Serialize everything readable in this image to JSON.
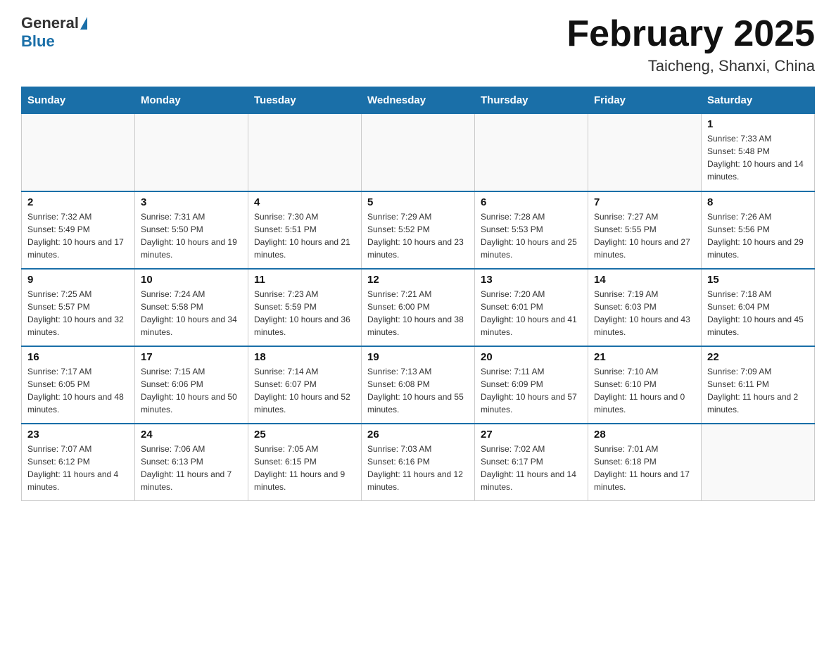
{
  "header": {
    "logo_text_general": "General",
    "logo_text_blue": "Blue",
    "title": "February 2025",
    "subtitle": "Taicheng, Shanxi, China"
  },
  "weekdays": [
    "Sunday",
    "Monday",
    "Tuesday",
    "Wednesday",
    "Thursday",
    "Friday",
    "Saturday"
  ],
  "weeks": [
    [
      {
        "day": "",
        "info": ""
      },
      {
        "day": "",
        "info": ""
      },
      {
        "day": "",
        "info": ""
      },
      {
        "day": "",
        "info": ""
      },
      {
        "day": "",
        "info": ""
      },
      {
        "day": "",
        "info": ""
      },
      {
        "day": "1",
        "info": "Sunrise: 7:33 AM\nSunset: 5:48 PM\nDaylight: 10 hours and 14 minutes."
      }
    ],
    [
      {
        "day": "2",
        "info": "Sunrise: 7:32 AM\nSunset: 5:49 PM\nDaylight: 10 hours and 17 minutes."
      },
      {
        "day": "3",
        "info": "Sunrise: 7:31 AM\nSunset: 5:50 PM\nDaylight: 10 hours and 19 minutes."
      },
      {
        "day": "4",
        "info": "Sunrise: 7:30 AM\nSunset: 5:51 PM\nDaylight: 10 hours and 21 minutes."
      },
      {
        "day": "5",
        "info": "Sunrise: 7:29 AM\nSunset: 5:52 PM\nDaylight: 10 hours and 23 minutes."
      },
      {
        "day": "6",
        "info": "Sunrise: 7:28 AM\nSunset: 5:53 PM\nDaylight: 10 hours and 25 minutes."
      },
      {
        "day": "7",
        "info": "Sunrise: 7:27 AM\nSunset: 5:55 PM\nDaylight: 10 hours and 27 minutes."
      },
      {
        "day": "8",
        "info": "Sunrise: 7:26 AM\nSunset: 5:56 PM\nDaylight: 10 hours and 29 minutes."
      }
    ],
    [
      {
        "day": "9",
        "info": "Sunrise: 7:25 AM\nSunset: 5:57 PM\nDaylight: 10 hours and 32 minutes."
      },
      {
        "day": "10",
        "info": "Sunrise: 7:24 AM\nSunset: 5:58 PM\nDaylight: 10 hours and 34 minutes."
      },
      {
        "day": "11",
        "info": "Sunrise: 7:23 AM\nSunset: 5:59 PM\nDaylight: 10 hours and 36 minutes."
      },
      {
        "day": "12",
        "info": "Sunrise: 7:21 AM\nSunset: 6:00 PM\nDaylight: 10 hours and 38 minutes."
      },
      {
        "day": "13",
        "info": "Sunrise: 7:20 AM\nSunset: 6:01 PM\nDaylight: 10 hours and 41 minutes."
      },
      {
        "day": "14",
        "info": "Sunrise: 7:19 AM\nSunset: 6:03 PM\nDaylight: 10 hours and 43 minutes."
      },
      {
        "day": "15",
        "info": "Sunrise: 7:18 AM\nSunset: 6:04 PM\nDaylight: 10 hours and 45 minutes."
      }
    ],
    [
      {
        "day": "16",
        "info": "Sunrise: 7:17 AM\nSunset: 6:05 PM\nDaylight: 10 hours and 48 minutes."
      },
      {
        "day": "17",
        "info": "Sunrise: 7:15 AM\nSunset: 6:06 PM\nDaylight: 10 hours and 50 minutes."
      },
      {
        "day": "18",
        "info": "Sunrise: 7:14 AM\nSunset: 6:07 PM\nDaylight: 10 hours and 52 minutes."
      },
      {
        "day": "19",
        "info": "Sunrise: 7:13 AM\nSunset: 6:08 PM\nDaylight: 10 hours and 55 minutes."
      },
      {
        "day": "20",
        "info": "Sunrise: 7:11 AM\nSunset: 6:09 PM\nDaylight: 10 hours and 57 minutes."
      },
      {
        "day": "21",
        "info": "Sunrise: 7:10 AM\nSunset: 6:10 PM\nDaylight: 11 hours and 0 minutes."
      },
      {
        "day": "22",
        "info": "Sunrise: 7:09 AM\nSunset: 6:11 PM\nDaylight: 11 hours and 2 minutes."
      }
    ],
    [
      {
        "day": "23",
        "info": "Sunrise: 7:07 AM\nSunset: 6:12 PM\nDaylight: 11 hours and 4 minutes."
      },
      {
        "day": "24",
        "info": "Sunrise: 7:06 AM\nSunset: 6:13 PM\nDaylight: 11 hours and 7 minutes."
      },
      {
        "day": "25",
        "info": "Sunrise: 7:05 AM\nSunset: 6:15 PM\nDaylight: 11 hours and 9 minutes."
      },
      {
        "day": "26",
        "info": "Sunrise: 7:03 AM\nSunset: 6:16 PM\nDaylight: 11 hours and 12 minutes."
      },
      {
        "day": "27",
        "info": "Sunrise: 7:02 AM\nSunset: 6:17 PM\nDaylight: 11 hours and 14 minutes."
      },
      {
        "day": "28",
        "info": "Sunrise: 7:01 AM\nSunset: 6:18 PM\nDaylight: 11 hours and 17 minutes."
      },
      {
        "day": "",
        "info": ""
      }
    ]
  ]
}
